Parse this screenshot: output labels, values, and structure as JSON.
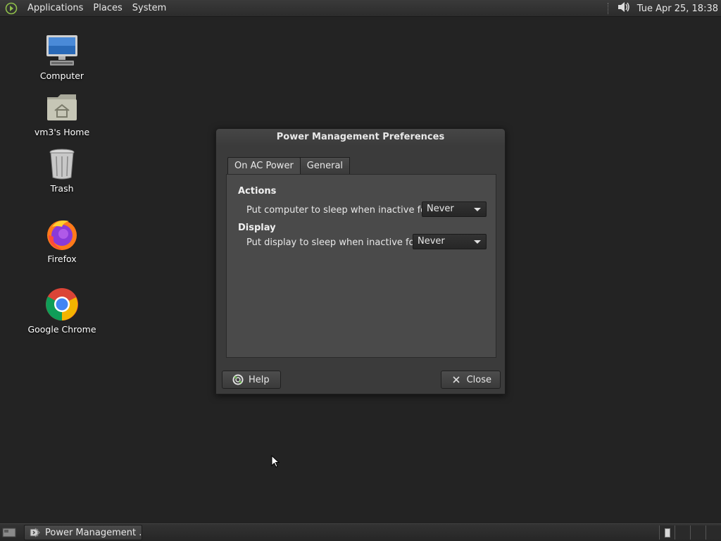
{
  "top_panel": {
    "menus": [
      "Applications",
      "Places",
      "System"
    ],
    "clock": "Tue Apr 25, 18:38"
  },
  "desktop_icons": [
    {
      "label": "Computer",
      "icon": "computer-icon"
    },
    {
      "label": "vm3's Home",
      "icon": "home-folder-icon"
    },
    {
      "label": "Trash",
      "icon": "trash-icon"
    },
    {
      "label": "Firefox",
      "icon": "firefox-icon"
    },
    {
      "label": "Google Chrome",
      "icon": "chrome-icon"
    }
  ],
  "dialog": {
    "title": "Power Management Preferences",
    "tabs": [
      {
        "label": "On AC Power",
        "active": true
      },
      {
        "label": "General",
        "active": false
      }
    ],
    "sections": {
      "actions": {
        "heading": "Actions",
        "row_label": "Put computer to sleep when inactive for:",
        "value": "Never"
      },
      "display": {
        "heading": "Display",
        "row_label": "Put display to sleep when inactive for:",
        "value": "Never"
      }
    },
    "buttons": {
      "help": "Help",
      "close": "Close"
    }
  },
  "taskbar": {
    "window_button": "Power Management ..."
  }
}
